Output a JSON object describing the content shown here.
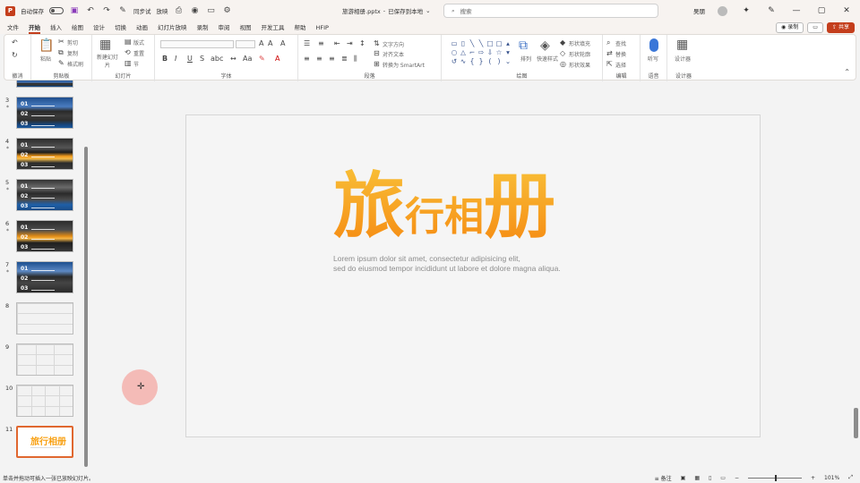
{
  "titlebar": {
    "autosave_label": "自动保存",
    "toolbar_item": "同步试",
    "view_item": "放映",
    "file_title": "旅游相册.pptx",
    "save_status": "已保存到本地",
    "search_placeholder": "搜索",
    "user_name": "吴朋"
  },
  "tabs": {
    "items": [
      "文件",
      "开始",
      "插入",
      "绘图",
      "设计",
      "切换",
      "动画",
      "幻灯片放映",
      "录制",
      "审阅",
      "视图",
      "开发工具",
      "帮助",
      "HFIP"
    ],
    "active_index": 1,
    "record_label": "录制",
    "share_label": "共享"
  },
  "ribbon": {
    "groups": [
      "撤消",
      "剪贴板",
      "幻灯片",
      "字体",
      "段落",
      "绘图",
      "编辑",
      "语音",
      "设计器"
    ],
    "clipboard": {
      "paste": "粘贴",
      "cut": "剪切",
      "copy": "复制",
      "format": "格式刷"
    },
    "slides": {
      "new": "新建幻灯片",
      "layout": "版式",
      "reset": "重置",
      "section": "节"
    },
    "paragraph": {
      "text_dir": "文字方向",
      "align_text": "对齐文本",
      "smartart": "转换为 SmartArt"
    },
    "drawing": {
      "arrange": "排列",
      "quick_styles": "快速样式",
      "fill": "形状填充",
      "outline": "形状轮廓",
      "effects": "形状效果"
    },
    "editing": {
      "find": "查找",
      "replace": "替换",
      "select": "选择"
    },
    "voice": {
      "dictate": "听写"
    },
    "designer": {
      "label": "设计器"
    }
  },
  "slides_panel": {
    "thumbs": [
      {
        "num": "3",
        "kind": "photo-a",
        "labels": [
          "01",
          "02",
          "03"
        ]
      },
      {
        "num": "4",
        "kind": "photo-b",
        "labels": [
          "01",
          "02",
          "03"
        ]
      },
      {
        "num": "5",
        "kind": "photo-c",
        "labels": [
          "01",
          "02",
          "03"
        ]
      },
      {
        "num": "6",
        "kind": "photo-d",
        "labels": [
          "01",
          "02",
          "03"
        ]
      },
      {
        "num": "7",
        "kind": "photo-e",
        "labels": [
          "01",
          "02",
          "03"
        ]
      },
      {
        "num": "8",
        "kind": "table-a"
      },
      {
        "num": "9",
        "kind": "table-b"
      },
      {
        "num": "10",
        "kind": "table-c"
      },
      {
        "num": "11",
        "kind": "title",
        "title": "旅行相册"
      }
    ],
    "star_glyph": "*"
  },
  "slide": {
    "title_chars": [
      "旅",
      "行",
      "相",
      "册"
    ],
    "lorem_1": "Lorem ipsum dolor sit amet, consectetur adipisicing elit,",
    "lorem_2": "sed do eiusmod tempor incididunt ut labore et dolore magna aliqua."
  },
  "statusbar": {
    "left_text": "单击并拖动可插入一张已放映幻灯片。",
    "notes_label": "备注",
    "zoom_percent": "101%"
  }
}
